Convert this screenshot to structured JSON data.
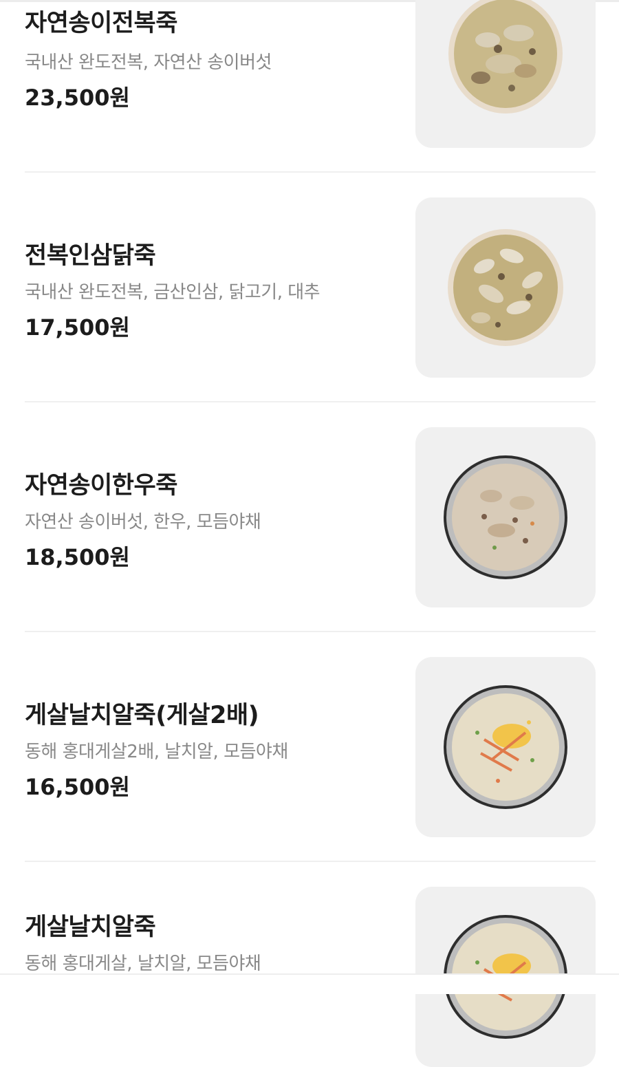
{
  "menu": {
    "items": [
      {
        "name": "자연송이전복죽",
        "desc": "국내산 완도전복, 자연산 송이버섯",
        "price": "23,500원",
        "image_icon": "abalone-mushroom-porridge-bowl",
        "bowl_style": "porcelain"
      },
      {
        "name": "전복인삼닭죽",
        "desc": "국내산 완도전복, 금산인삼, 닭고기, 대추",
        "price": "17,500원",
        "image_icon": "abalone-ginseng-chicken-porridge-bowl",
        "bowl_style": "porcelain"
      },
      {
        "name": "자연송이한우죽",
        "desc": "자연산 송이버섯, 한우, 모듬야채",
        "price": "18,500원",
        "image_icon": "mushroom-beef-porridge-bowl",
        "bowl_style": "steel"
      },
      {
        "name": "게살날치알죽(게살2배)",
        "desc": "동해 홍대게살2배, 날치알, 모듬야채",
        "price": "16,500원",
        "image_icon": "crab-roe-porridge-bowl",
        "bowl_style": "steel"
      },
      {
        "name": "게살날치알죽",
        "desc": "동해 홍대게살, 날치알, 모듬야채",
        "price": "",
        "image_icon": "crab-roe-porridge-bowl",
        "bowl_style": "steel"
      }
    ]
  },
  "colors": {
    "text": "#1c1c1c",
    "desc": "#888888",
    "thumb_bg": "#f0f0f0",
    "divider": "#efefef",
    "porridge_abalone": "#c9b98a",
    "porridge_beef": "#d8cbb8",
    "porridge_crab": "#e6ddc6",
    "crab_accent": "#e07a4a",
    "roe_accent": "#f2c44a"
  }
}
